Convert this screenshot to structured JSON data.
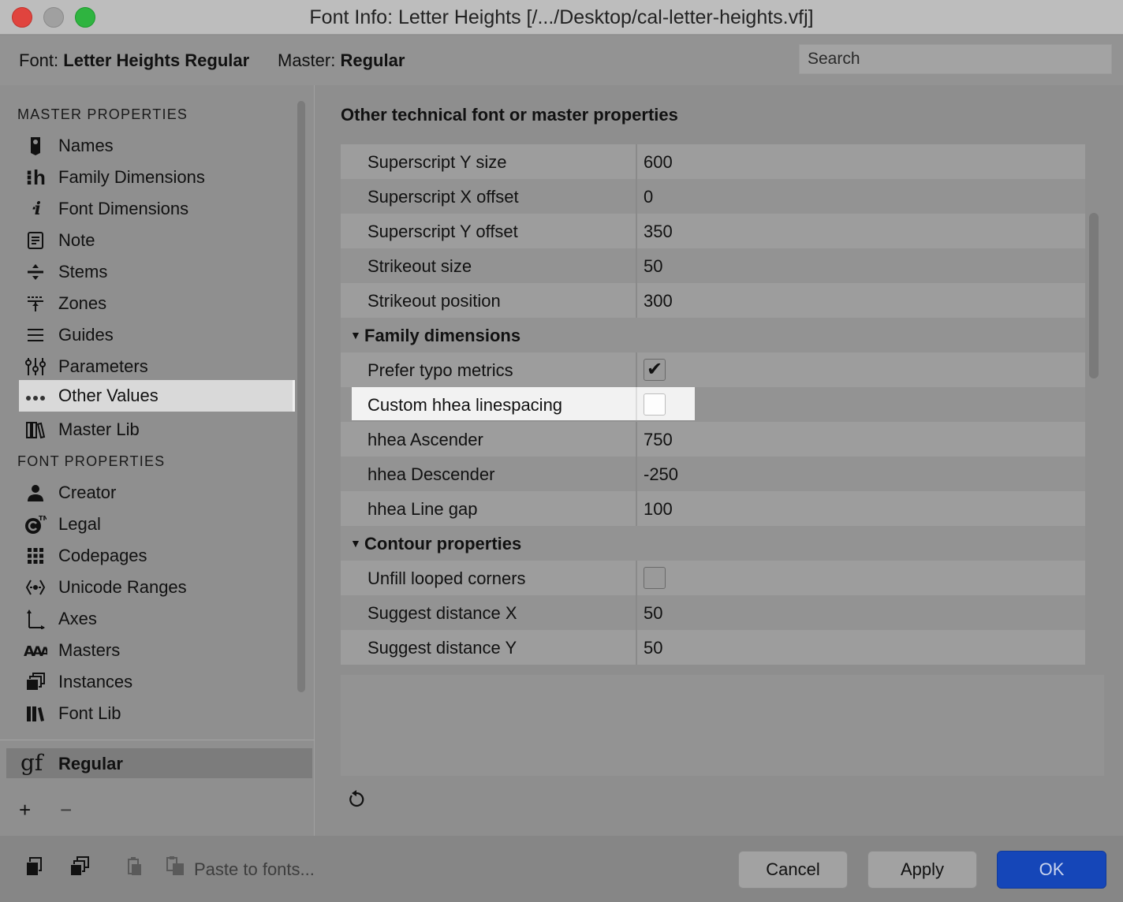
{
  "window": {
    "title": "Font Info: Letter Heights [/.../Desktop/cal-letter-heights.vfj]"
  },
  "header": {
    "font_label": "Font:",
    "font_name": "Letter Heights Regular",
    "master_label": "Master:",
    "master_name": "Regular",
    "search_placeholder": "Search"
  },
  "sidebar": {
    "master_section": "MASTER PROPERTIES",
    "master_items": [
      {
        "label": "Names",
        "icon": "tag-icon"
      },
      {
        "label": "Family Dimensions",
        "icon": "family-dimensions-icon"
      },
      {
        "label": "Font Dimensions",
        "icon": "font-dimensions-icon"
      },
      {
        "label": "Note",
        "icon": "note-icon"
      },
      {
        "label": "Stems",
        "icon": "stems-icon"
      },
      {
        "label": "Zones",
        "icon": "zones-icon"
      },
      {
        "label": "Guides",
        "icon": "guides-icon"
      },
      {
        "label": "Parameters",
        "icon": "parameters-icon"
      },
      {
        "label": "Other Values",
        "icon": "ellipsis-icon",
        "selected": true
      },
      {
        "label": "Master Lib",
        "icon": "books-icon"
      }
    ],
    "font_section": "FONT PROPERTIES",
    "font_items": [
      {
        "label": "Creator",
        "icon": "person-icon"
      },
      {
        "label": "Legal",
        "icon": "copyright-icon"
      },
      {
        "label": "Codepages",
        "icon": "grid-icon"
      },
      {
        "label": "Unicode Ranges",
        "icon": "unicode-ranges-icon"
      },
      {
        "label": "Axes",
        "icon": "axes-icon"
      },
      {
        "label": "Masters",
        "icon": "masters-icon"
      },
      {
        "label": "Instances",
        "icon": "instances-icon"
      },
      {
        "label": "Font Lib",
        "icon": "books-icon"
      }
    ],
    "master_row": {
      "icon_text": "gf",
      "label": "Regular"
    },
    "add": "+",
    "remove": "−"
  },
  "main": {
    "title": "Other technical font or master properties",
    "rows": [
      {
        "type": "value",
        "key": "Superscript Y size",
        "value": "600"
      },
      {
        "type": "value",
        "key": "Superscript X offset",
        "value": "0"
      },
      {
        "type": "value",
        "key": "Superscript Y offset",
        "value": "350"
      },
      {
        "type": "value",
        "key": "Strikeout size",
        "value": "50"
      },
      {
        "type": "value",
        "key": "Strikeout position",
        "value": "300"
      },
      {
        "type": "group",
        "key": "Family dimensions"
      },
      {
        "type": "check",
        "key": "Prefer typo metrics",
        "checked": true
      },
      {
        "type": "check",
        "key": "Custom hhea linespacing",
        "checked": false,
        "highlight": true
      },
      {
        "type": "value",
        "key": "hhea Ascender",
        "value": "750"
      },
      {
        "type": "value",
        "key": "hhea Descender",
        "value": "-250"
      },
      {
        "type": "value",
        "key": "hhea Line gap",
        "value": "100"
      },
      {
        "type": "group",
        "key": "Contour properties"
      },
      {
        "type": "check",
        "key": "Unfill looped corners",
        "checked": false
      },
      {
        "type": "value",
        "key": "Suggest distance X",
        "value": "50"
      },
      {
        "type": "value",
        "key": "Suggest distance Y",
        "value": "50"
      }
    ]
  },
  "footer": {
    "paste_label": "Paste to fonts...",
    "cancel": "Cancel",
    "apply": "Apply",
    "ok": "OK"
  },
  "colors": {
    "ok_button": "#1546b8",
    "selected_item": "#d9d9d9",
    "close": "#e0443e",
    "maximize": "#2fb440"
  }
}
